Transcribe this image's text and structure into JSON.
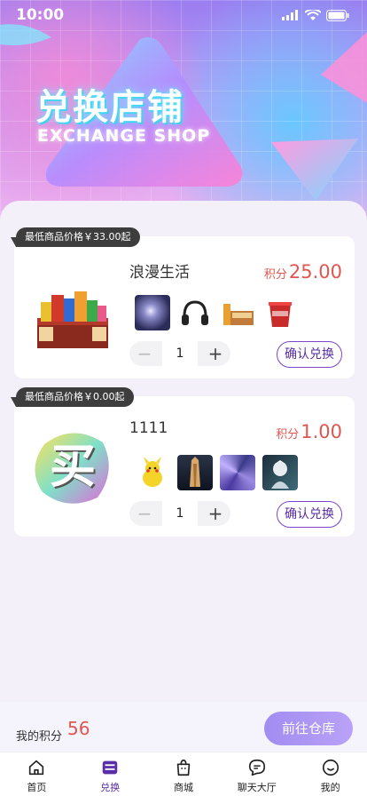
{
  "status_bar": {
    "time": "10:00"
  },
  "header": {
    "title_cn": "兑换店铺",
    "title_en": "EXCHANGE SHOP"
  },
  "products": [
    {
      "badge": "最低商品价格￥33.00起",
      "name": "浪漫生活",
      "price_label": "积分",
      "price_value": "25.00",
      "quantity": "1",
      "decrement_label": "−",
      "increment_label": "+",
      "confirm_label": "确认兑换",
      "thumbs": [
        "moon-painting",
        "headphones",
        "snack-box",
        "red-tub"
      ]
    },
    {
      "badge": "最低商品价格￥0.00起",
      "name": "1111",
      "price_label": "积分",
      "price_value": "1.00",
      "quantity": "1",
      "decrement_label": "−",
      "increment_label": "+",
      "confirm_label": "确认兑换",
      "logo_char": "买",
      "thumbs": [
        "pikachu",
        "wooden-figure",
        "purple-art",
        "anime-character"
      ]
    }
  ],
  "footer": {
    "points_label": "我的积分",
    "points_value": "56",
    "warehouse_button": "前往仓库"
  },
  "tabbar": [
    {
      "label": "首页",
      "icon": "home-icon"
    },
    {
      "label": "兑换",
      "icon": "exchange-icon",
      "active": true
    },
    {
      "label": "商城",
      "icon": "shop-bag-icon"
    },
    {
      "label": "聊天大厅",
      "icon": "chat-icon"
    },
    {
      "label": "我的",
      "icon": "profile-icon"
    }
  ],
  "colors": {
    "accent": "#5a2ea6",
    "price": "#e0564f",
    "badge": "#3d3d3d"
  }
}
